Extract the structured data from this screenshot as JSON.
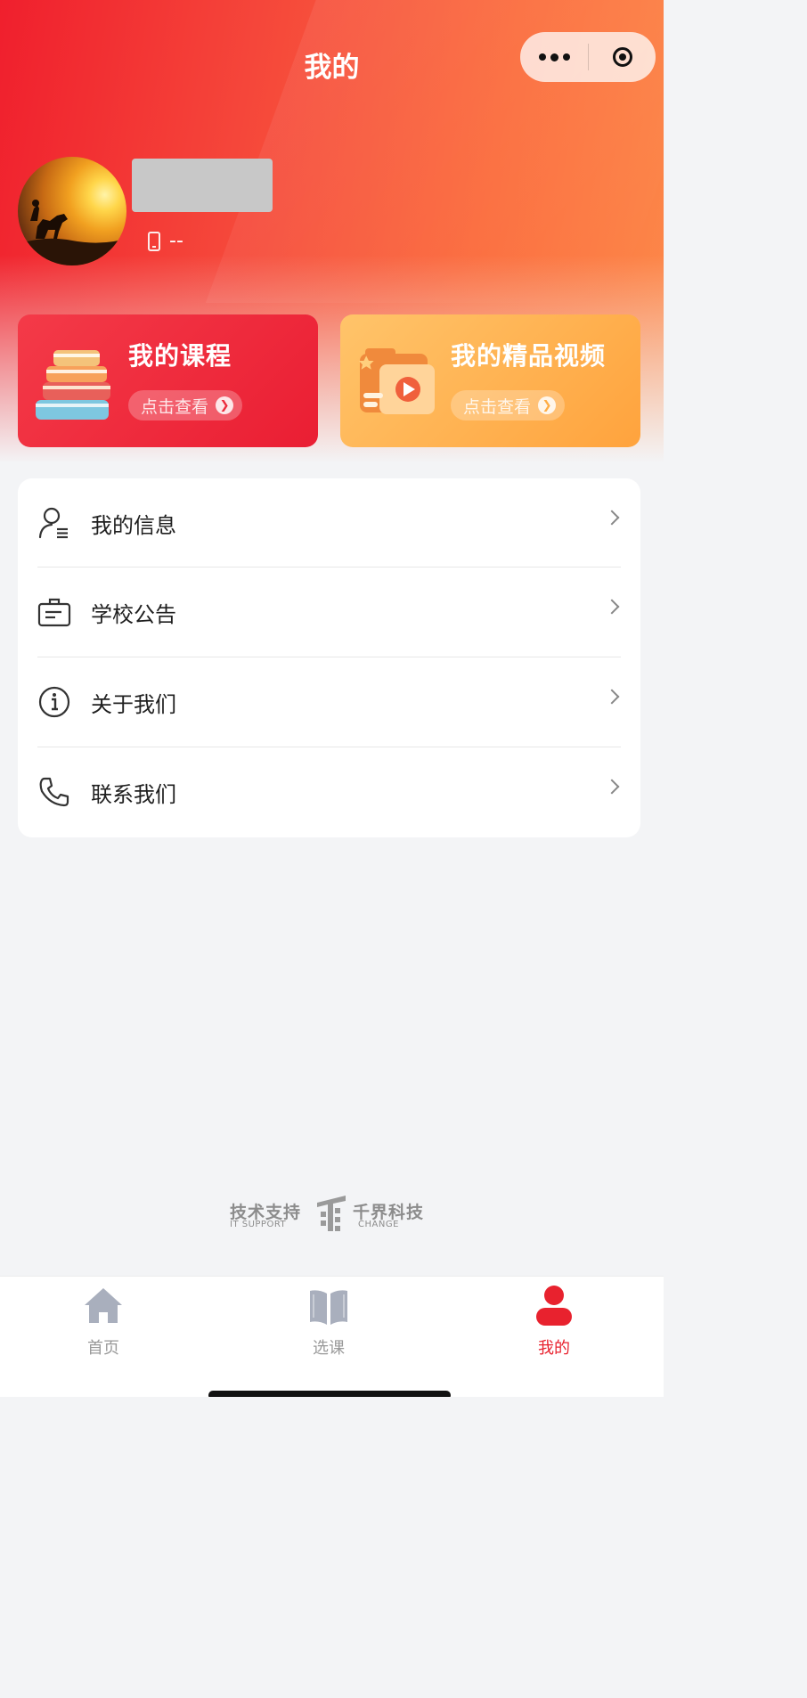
{
  "header": {
    "title": "我的"
  },
  "capsule": {
    "more_icon": "more-dots-icon",
    "close_icon": "target-circle-icon"
  },
  "profile": {
    "avatar_icon": "avatar-image",
    "phone_icon": "phone-icon",
    "phone_value": "--"
  },
  "cards": [
    {
      "title": "我的课程",
      "button": "点击查看",
      "icon": "books-icon",
      "color": "#ec2c3d"
    },
    {
      "title": "我的精品视频",
      "button": "点击查看",
      "icon": "video-folder-icon",
      "color": "#ffad45"
    }
  ],
  "menu": [
    {
      "label": "我的信息",
      "icon": "user-info-icon"
    },
    {
      "label": "学校公告",
      "icon": "notice-icon"
    },
    {
      "label": "关于我们",
      "icon": "info-icon"
    },
    {
      "label": "联系我们",
      "icon": "phone-call-icon"
    }
  ],
  "footer": {
    "support_cn": "技术支持",
    "support_en": "IT SUPPORT",
    "company_cn": "千界科技",
    "company_en": "CHANGE"
  },
  "tabbar": [
    {
      "label": "首页",
      "icon": "home-icon",
      "active": false
    },
    {
      "label": "选课",
      "icon": "book-open-icon",
      "active": false
    },
    {
      "label": "我的",
      "icon": "person-icon",
      "active": true
    }
  ],
  "colors": {
    "accent": "#e8222e",
    "inactive": "#999999"
  }
}
